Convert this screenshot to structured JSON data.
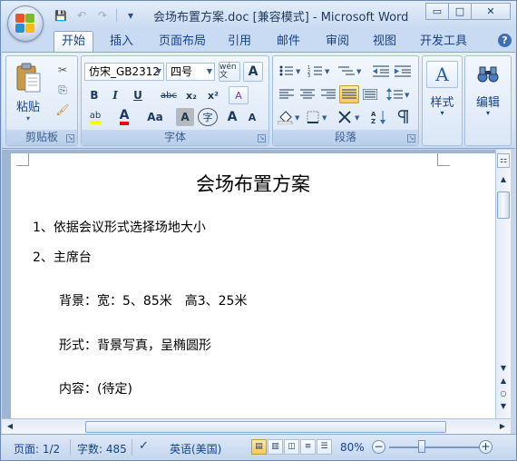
{
  "window": {
    "title": "会场布置方案.doc [兼容模式] - Microsoft Word",
    "minimize_glyph": "▭",
    "maximize_glyph": "□",
    "close_glyph": "✕"
  },
  "quick_access": {
    "save_icon": "💾",
    "undo_icon": "↶",
    "redo_icon": "↷",
    "customize_icon": "▾"
  },
  "tabs": [
    {
      "label": "开始",
      "active": true
    },
    {
      "label": "插入"
    },
    {
      "label": "页面布局"
    },
    {
      "label": "引用"
    },
    {
      "label": "邮件"
    },
    {
      "label": "审阅"
    },
    {
      "label": "视图"
    },
    {
      "label": "开发工具"
    }
  ],
  "help_label": "?",
  "ribbon": {
    "clipboard": {
      "group_label": "剪贴板",
      "paste_label": "粘贴",
      "paste_arrow": "▾",
      "cut_glyph": "✂",
      "copy_glyph": "⎘",
      "format_painter_glyph": "🖌"
    },
    "font": {
      "group_label": "字体",
      "font_name": "仿宋_GB2312",
      "font_size": "四号",
      "phonetic_label": "wén 文",
      "char_border_label": "A",
      "bold": "B",
      "italic": "I",
      "underline": "U",
      "strike": "abc",
      "subscript": "x₂",
      "superscript": "x²",
      "clear_format": "A",
      "highlight": "ab",
      "font_color": "A",
      "change_case": "Aa",
      "char_shading": "A",
      "enclose_char": "字",
      "grow_font": "A",
      "shrink_font": "A"
    },
    "paragraph": {
      "group_label": "段落"
    },
    "styles": {
      "label": "样式",
      "icon": "A"
    },
    "editing": {
      "label": "编辑",
      "icon": "A"
    }
  },
  "document": {
    "title": "会场布置方案",
    "lines": [
      "1、依据会议形式选择场地大小",
      "2、主席台",
      "背景：宽：5、85米　高3、25米",
      "形式：背景写真，呈椭圆形",
      "内容：(待定)"
    ]
  },
  "status_bar": {
    "page": "页面: 1/2",
    "words": "字数: 485",
    "language": "英语(美国)",
    "zoom": "80%",
    "zoom_out": "−",
    "zoom_in": "+",
    "zoom_value": 0.8
  },
  "colors": {
    "highlight": "#ffff00",
    "font_color": "#ff0000"
  }
}
